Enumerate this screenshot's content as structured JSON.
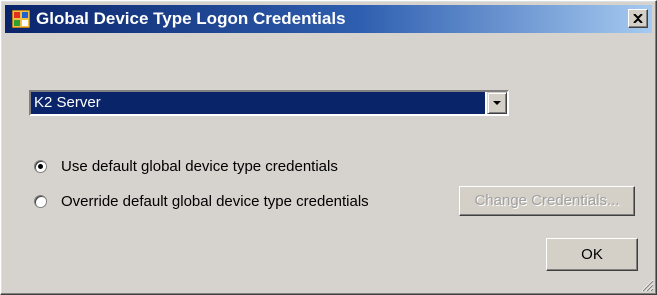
{
  "window": {
    "title": "Global Device Type Logon Credentials",
    "close_glyph": "✕"
  },
  "device_type": {
    "selected": "K2 Server"
  },
  "options": [
    {
      "label": "Use default global device type credentials",
      "checked": true
    },
    {
      "label": "Override default global device type credentials",
      "checked": false
    }
  ],
  "buttons": {
    "change_credentials": "Change Credentials...",
    "ok": "OK"
  },
  "icons": {
    "title": "app-window-icon",
    "close": "close-icon",
    "dropdown": "chevron-down-icon",
    "resize": "resize-grip-icon"
  },
  "colors": {
    "title_gradient_start": "#0a246a",
    "title_gradient_end": "#a6caf0",
    "selection": "#0a246a",
    "face": "#d4d0c8"
  }
}
